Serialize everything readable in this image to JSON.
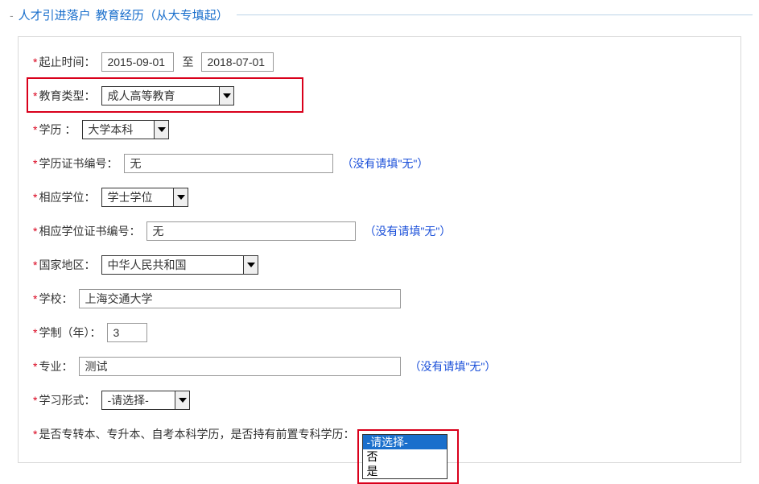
{
  "header": {
    "title1": "人才引进落户",
    "title2": "教育经历（从大专填起）"
  },
  "form": {
    "period": {
      "label": "起止时间：",
      "start": "2015-09-01",
      "to": "至",
      "end": "2018-07-01"
    },
    "eduType": {
      "label": "教育类型：",
      "value": "成人高等教育"
    },
    "degree": {
      "label": "学历 ：",
      "value": "大学本科"
    },
    "degreeCert": {
      "label": "学历证书编号：",
      "value": "无",
      "hint": "（没有请填\"无\"）"
    },
    "academicDegree": {
      "label": "相应学位：",
      "value": "学士学位"
    },
    "academicDegreeCert": {
      "label": "相应学位证书编号：",
      "value": "无",
      "hint": "（没有请填\"无\"）"
    },
    "country": {
      "label": "国家地区：",
      "value": "中华人民共和国"
    },
    "school": {
      "label": "学校：",
      "value": "上海交通大学"
    },
    "years": {
      "label": "学制（年）：",
      "value": "3"
    },
    "major": {
      "label": "专业：",
      "value": "测试",
      "hint": "（没有请填\"无\"）"
    },
    "studyMode": {
      "label": "学习形式：",
      "value": "-请选择-"
    },
    "preDiploma": {
      "label": "是否专转本、专升本、自考本科学历，是否持有前置专科学历：",
      "options": [
        "-请选择-",
        "否",
        "是"
      ],
      "selectedIndex": 0
    }
  }
}
